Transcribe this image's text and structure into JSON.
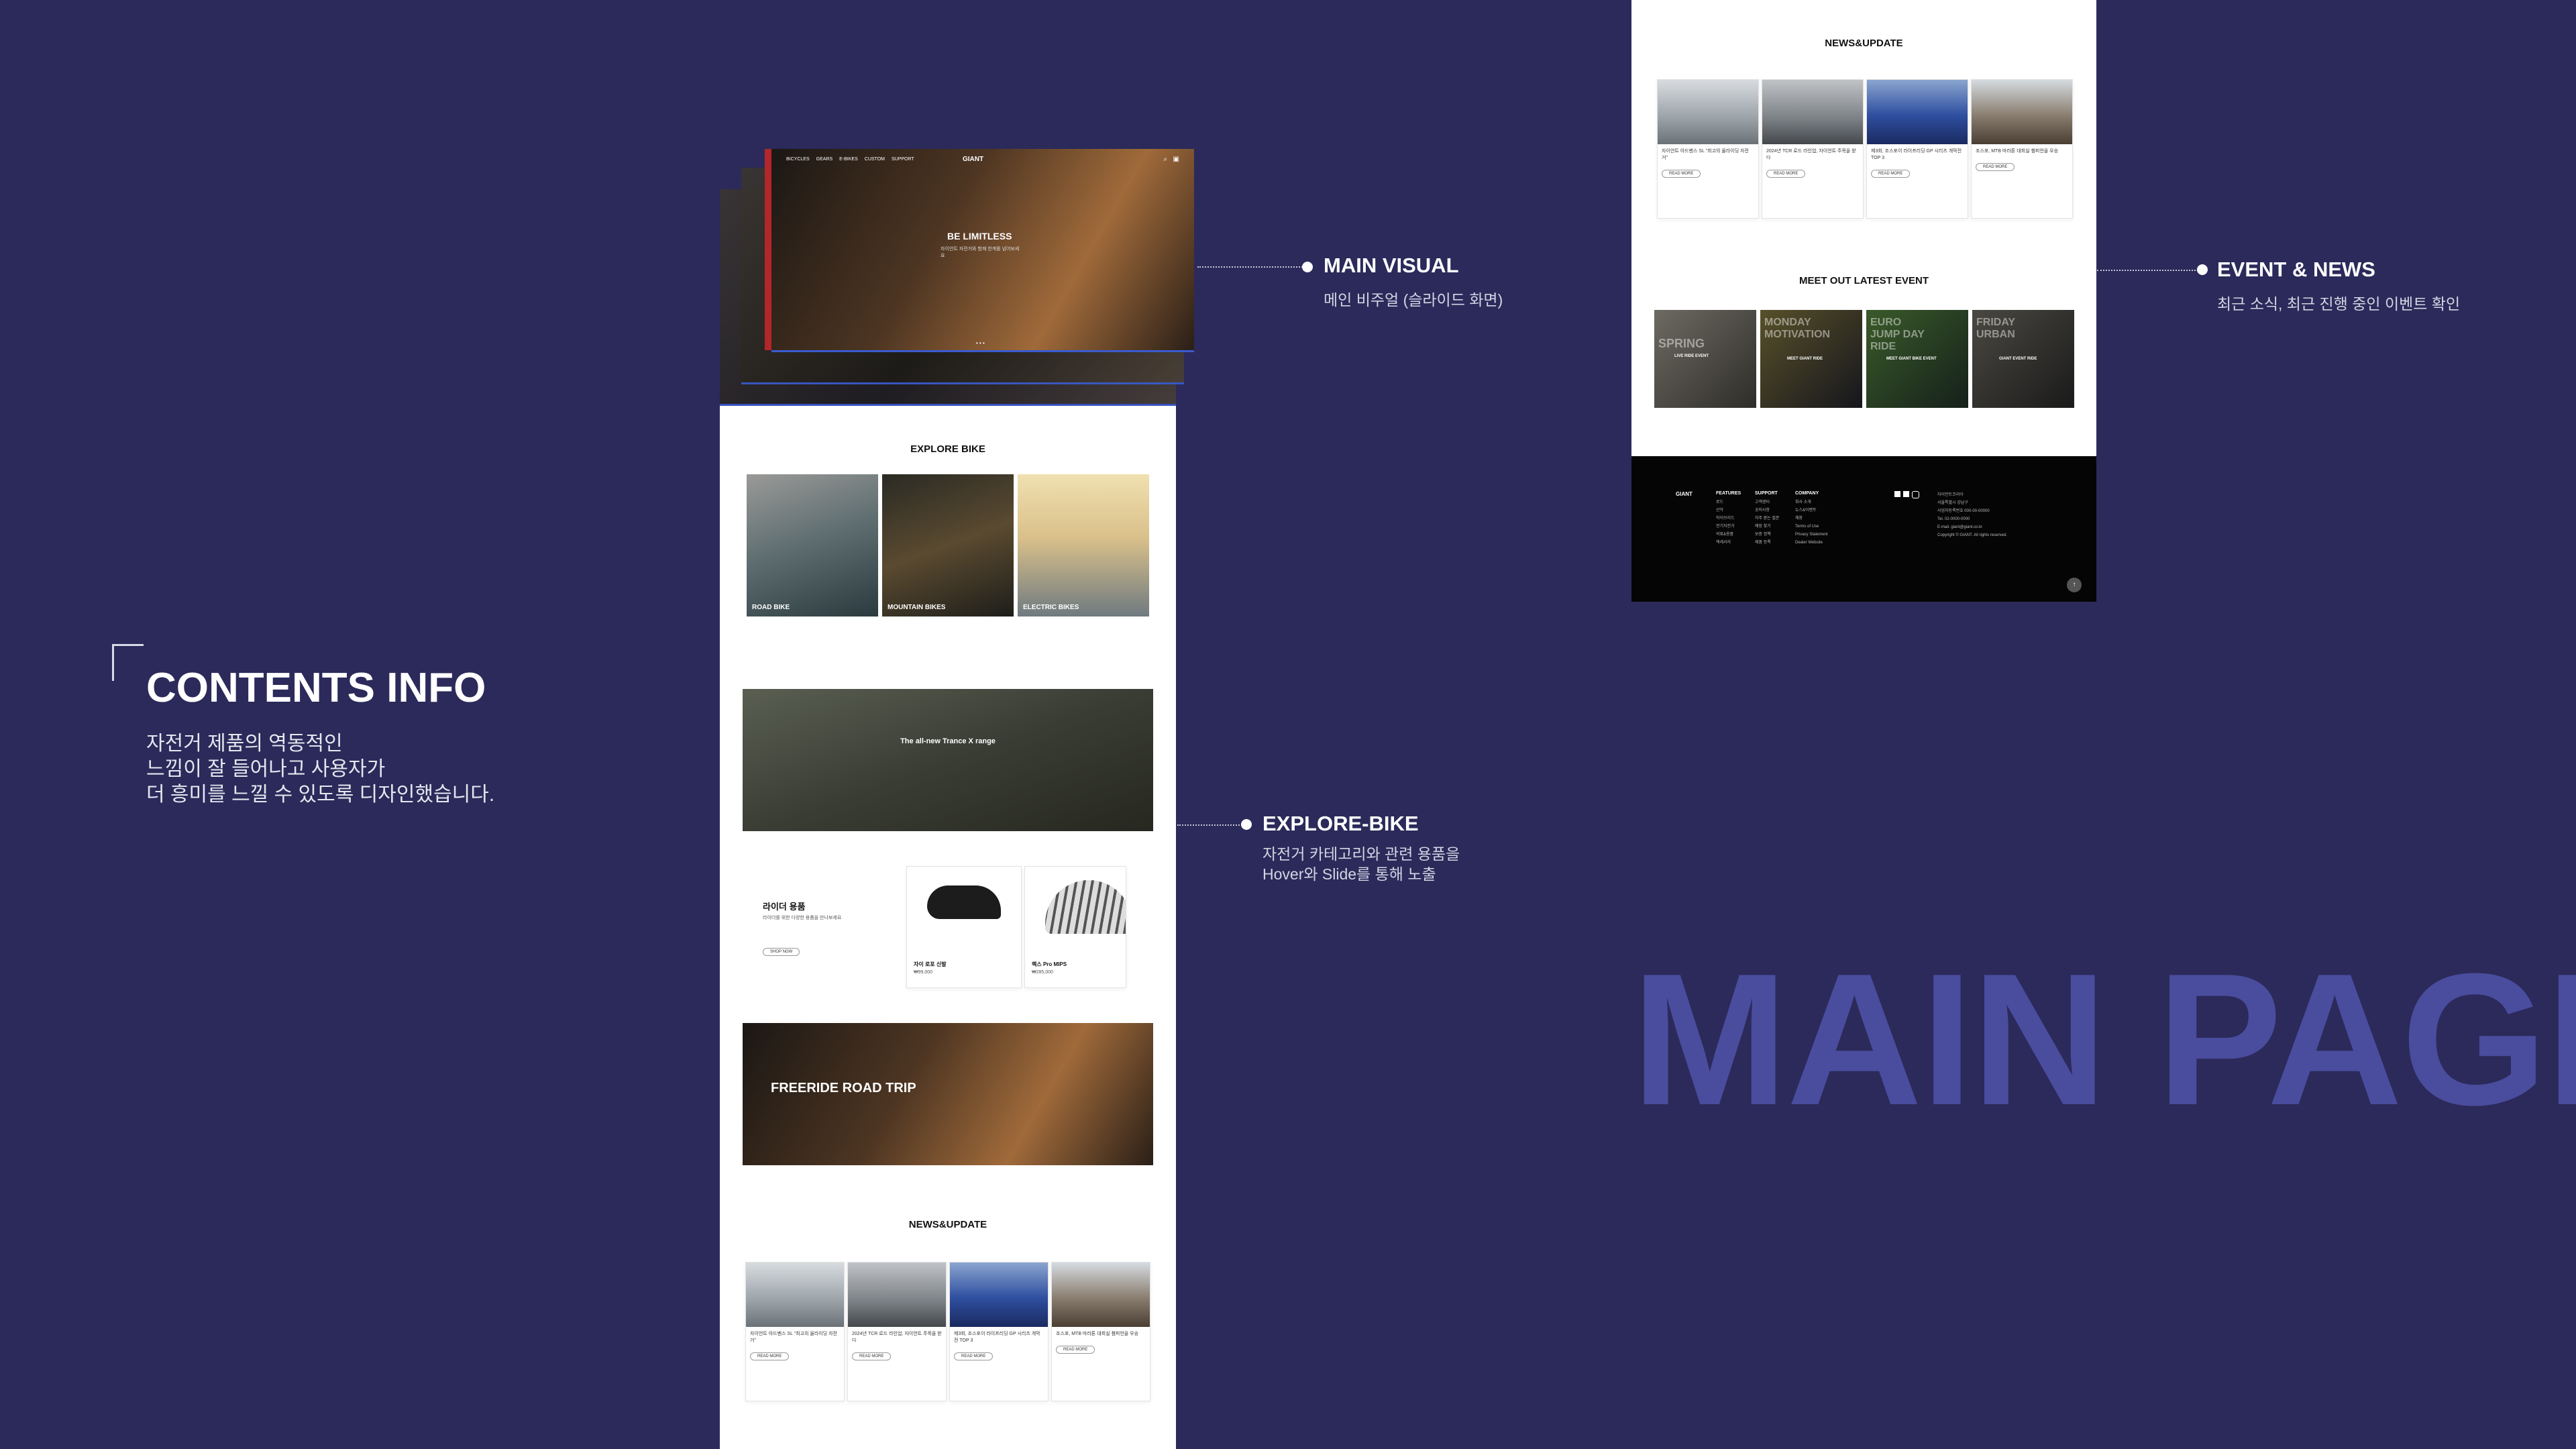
{
  "contents_info": {
    "title": "CONTENTS INFO",
    "lines": [
      "자전거 제품의 역동적인",
      "느낌이 잘 들어나고 사용자가",
      "더 흥미를 느낄 수 있도록 디자인했습니다."
    ]
  },
  "callouts": {
    "main_visual": {
      "title": "MAIN VISUAL",
      "desc": "메인 비주얼 (슬라이드 화면)"
    },
    "explore_bike": {
      "title": "EXPLORE-BIKE",
      "desc_lines": [
        "자전거 카테고리와 관련 용품을",
        "Hover와 Slide를 통해 노출"
      ]
    },
    "event_news": {
      "title": "EVENT & NEWS",
      "desc": "최근 소식, 최근 진행 중인 이벤트 확인"
    }
  },
  "watermark": "MAIN PAGE",
  "site": {
    "logo": "GIANT",
    "nav": [
      "BICYCLES",
      "GEARS",
      "E-BIKES",
      "CUSTOM",
      "SUPPORT"
    ],
    "hero": {
      "title": "BE LIMITLESS",
      "sub": "자이언트 자전거와 함께 한계를 넘어보세요"
    },
    "explore_title": "EXPLORE BIKE",
    "categories": [
      "ROAD BIKE",
      "MOUNTAIN BIKES",
      "ELECTRIC BIKES"
    ],
    "banner_text": "The all-new Trance X range",
    "gear": {
      "title": "라이더 용품",
      "desc": "라이더를 위한 다양한 용품을 만나보세요",
      "btn": "SHOP NOW",
      "items": [
        {
          "name": "자이 로포 신발",
          "price": "₩99,000"
        },
        {
          "name": "렉스 Pro MIPS",
          "price": "₩285,000"
        }
      ]
    },
    "trip_text": "FREERIDE ROAD TRIP",
    "news_title": "NEWS&UPDATE",
    "news": [
      {
        "title": "자이언트 아드벤스 SL \"최고의 올라이딩 자전거\"",
        "btn": "READ MORE"
      },
      {
        "title": "2024년 TCR 로드 라인업, 자이언트 주목을 받다",
        "btn": "READ MORE"
      },
      {
        "title": "제3회, 조스포이 라이프리딩 GP 시리즈 개막전 TOP 3",
        "btn": "READ MORE"
      },
      {
        "title": "조스포, MTB 마라톤 대회실 챔피언을 우승",
        "btn": "READ MORE"
      }
    ],
    "event_title": "MEET OUT LATEST EVENT",
    "events": [
      {
        "big": "SPRING",
        "small": "LIVE RIDE EVENT"
      },
      {
        "big": "MONDAY MOTIVATION",
        "small": "MEET GIANT RIDE"
      },
      {
        "big": "EURO JUMP DAY RIDE",
        "small": "MEET GIANT BIKE EVENT"
      },
      {
        "big": "FRIDAY URBAN",
        "small": "GIANT EVENT RIDE"
      }
    ],
    "footer": {
      "cols": [
        {
          "head": "FEATURES",
          "items": [
            "로드",
            "산악",
            "하이브리드",
            "전기자전거",
            "의류&용품",
            "액세서리"
          ]
        },
        {
          "head": "SUPPORT",
          "items": [
            "고객센터",
            "공지사항",
            "자주 묻는 질문",
            "매장 찾기",
            "보증 정책",
            "제품 등록"
          ]
        },
        {
          "head": "COMPANY",
          "items": [
            "회사 소개",
            "뉴스&이벤트",
            "채용",
            "Terms of Use",
            "Privacy Statement",
            "Dealer Website"
          ]
        }
      ],
      "info": [
        "자이언트코리아",
        "서울특별시 강남구",
        "사업자등록번호 000-00-00000",
        "Tel. 02-0000-0000",
        "E-mail. giant@giant.co.kr",
        "Copyright © GIANT. All rights reserved."
      ]
    }
  }
}
